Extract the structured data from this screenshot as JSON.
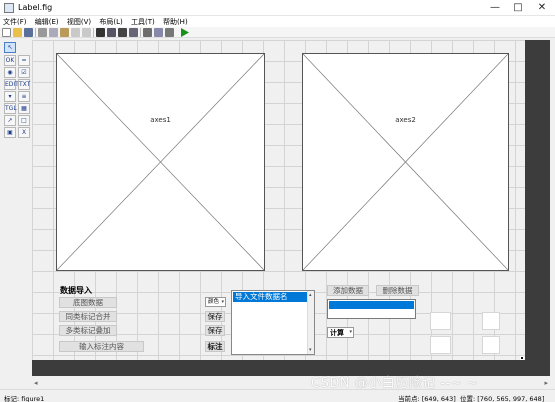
{
  "window": {
    "title": "Label.fig",
    "minimize": "—",
    "maximize": "□",
    "close": "✕"
  },
  "menu": [
    {
      "label": "文件(F)"
    },
    {
      "label": "编辑(E)"
    },
    {
      "label": "视图(V)"
    },
    {
      "label": "布局(L)"
    },
    {
      "label": "工具(T)"
    },
    {
      "label": "帮助(H)"
    }
  ],
  "toolbar": {
    "icons": [
      "new-file-icon",
      "open-folder-icon",
      "save-icon",
      "cut-icon",
      "copy-icon",
      "paste-icon",
      "undo-icon",
      "redo-icon",
      "align-icon",
      "menu-editor-icon",
      "tab-order-icon",
      "toolbar-editor-icon",
      "m-file-icon",
      "property-inspector-icon",
      "object-browser-icon",
      "run-icon"
    ],
    "accent": "#1a8f1a"
  },
  "palette": [
    {
      "icon": "select-arrow-icon",
      "glyph": "↖"
    },
    {
      "icon": "push-button-icon",
      "glyph": "OK"
    },
    {
      "icon": "slider-icon",
      "glyph": "═"
    },
    {
      "icon": "radio-button-icon",
      "glyph": "◉"
    },
    {
      "icon": "checkbox-icon",
      "glyph": "☑"
    },
    {
      "icon": "edit-text-icon",
      "glyph": "EDIT"
    },
    {
      "icon": "static-text-icon",
      "glyph": "TXT"
    },
    {
      "icon": "popup-menu-icon",
      "glyph": "▾"
    },
    {
      "icon": "listbox-icon",
      "glyph": "≡"
    },
    {
      "icon": "toggle-button-icon",
      "glyph": "TGL"
    },
    {
      "icon": "table-icon",
      "glyph": "▦"
    },
    {
      "icon": "axes-icon",
      "glyph": "↗"
    },
    {
      "icon": "panel-icon",
      "glyph": "□"
    },
    {
      "icon": "button-group-icon",
      "glyph": "▣"
    },
    {
      "icon": "activex-icon",
      "glyph": "X"
    }
  ],
  "axes": [
    {
      "label": "axes1"
    },
    {
      "label": "axes2"
    }
  ],
  "controls": {
    "panel_title": "数据导入",
    "base_data": "底图数据",
    "merge_same": "同类标记合并",
    "overlay_multi": "多类标记叠加",
    "input_label": "输入标注内容",
    "color_popup": "颜色",
    "save1": "保存",
    "save2": "保存",
    "annotate": "标注",
    "file_list_item": "导入文件数据名",
    "add_data": "添加数据",
    "delete_data": "删除数据",
    "compute": "计算",
    "list_selection_color": "#0078d7"
  },
  "status": {
    "tag": "标记: figure1",
    "current_point": "当前点: [649, 643]",
    "position": "位置: [760, 565, 997, 648]"
  },
  "watermark": "CSDN @小白历险记 --~ ~"
}
